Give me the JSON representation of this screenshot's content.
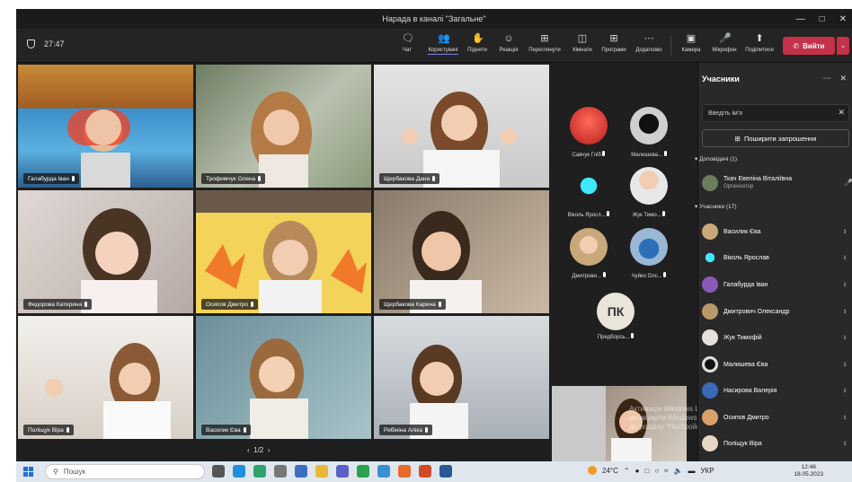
{
  "window": {
    "title": "Нарада в каналі \"Загальне\""
  },
  "toolbar": {
    "timer": "27:47",
    "items": [
      "Чат",
      "Користувачі",
      "Підняти",
      "Реакція",
      "Переглянути",
      "Кімнати",
      "Програми",
      "Додатково",
      "Камера",
      "Мікрофон",
      "Поділитися"
    ],
    "leave": "Вийти"
  },
  "stage": {
    "tiles": [
      {
        "name": "Галабурда Іван"
      },
      {
        "name": "Трофимчук Олена"
      },
      {
        "name": "Щербакова Дана"
      },
      {
        "name": "Федорова Катерина"
      },
      {
        "name": "Осипов Дмитро"
      },
      {
        "name": "Щербакова Карина"
      },
      {
        "name": "Поліщук Віра"
      },
      {
        "name": "Василик Єва"
      },
      {
        "name": "Рябініна Аліка"
      }
    ],
    "pager": "1/2"
  },
  "side_grid": {
    "avatars": [
      {
        "name": "Савчук Гліб"
      },
      {
        "name": "Малишева..."
      },
      {
        "name": "Віколь Яросл..."
      },
      {
        "name": "Жук Тимо..."
      },
      {
        "name": "Дмитрови..."
      },
      {
        "name": "Чуйко Олс..."
      }
    ],
    "pk": {
      "initials": "ПК",
      "name": "Предборсь..."
    },
    "watermark": "Активація Windows Щоб активувати Windows, перейдіть до розділу \"Настройки\"."
  },
  "panel": {
    "title": "Учасники",
    "search_placeholder": "Введіть ім'я",
    "share": "Поширити запрошення",
    "presenters_header": "Доповідачі (1)",
    "presenter": {
      "name": "Ткач Евеліна Віталіївна",
      "role": "Організатор"
    },
    "attendees_header": "Учасники (17)",
    "attendees": [
      "Василик Єва",
      "Віколь Ярослав",
      "Галабурда Іван",
      "Дмитрович Олександр",
      "Жук Тимофій",
      "Малишева Єва",
      "Насирова Валерія",
      "Осипов Дмитро",
      "Поліщук Віра"
    ]
  },
  "taskbar": {
    "search": "Пошук",
    "temp": "24°C",
    "lang": "УКР",
    "time": "12:48",
    "date": "18.05.2023"
  }
}
